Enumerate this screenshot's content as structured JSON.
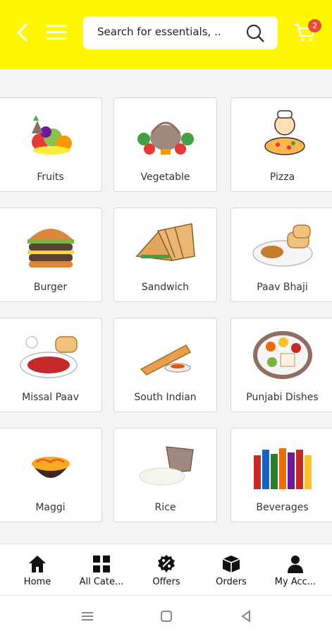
{
  "header": {
    "background": "#fff700",
    "back_icon": "chevron-left-icon",
    "menu_icon": "hamburger-icon",
    "search": {
      "placeholder": "Search for essentials, ..",
      "icon": "search-icon"
    },
    "cart": {
      "icon": "cart-icon",
      "count": "2"
    }
  },
  "categories": [
    {
      "label": "Fruits",
      "icon": "fruits-image"
    },
    {
      "label": "Vegetable",
      "icon": "vegetable-image"
    },
    {
      "label": "Pizza",
      "icon": "pizza-image"
    },
    {
      "label": "Burger",
      "icon": "burger-image"
    },
    {
      "label": "Sandwich",
      "icon": "sandwich-image"
    },
    {
      "label": "Paav Bhaji",
      "icon": "paav-bhaji-image"
    },
    {
      "label": "Missal Paav",
      "icon": "missal-paav-image"
    },
    {
      "label": "South Indian",
      "icon": "south-indian-image"
    },
    {
      "label": "Punjabi Dishes",
      "icon": "punjabi-dishes-image"
    },
    {
      "label": "Maggi",
      "icon": "maggi-image"
    },
    {
      "label": "Rice",
      "icon": "rice-image"
    },
    {
      "label": "Beverages",
      "icon": "beverages-image"
    }
  ],
  "bottom_nav": [
    {
      "label": "Home",
      "icon": "home-icon"
    },
    {
      "label": "All Cate...",
      "icon": "grid-icon"
    },
    {
      "label": "Offers",
      "icon": "offers-icon"
    },
    {
      "label": "Orders",
      "icon": "box-icon"
    },
    {
      "label": "My Acc...",
      "icon": "user-icon"
    }
  ],
  "system_nav": [
    "recents-icon",
    "home-square-icon",
    "back-triangle-icon"
  ]
}
